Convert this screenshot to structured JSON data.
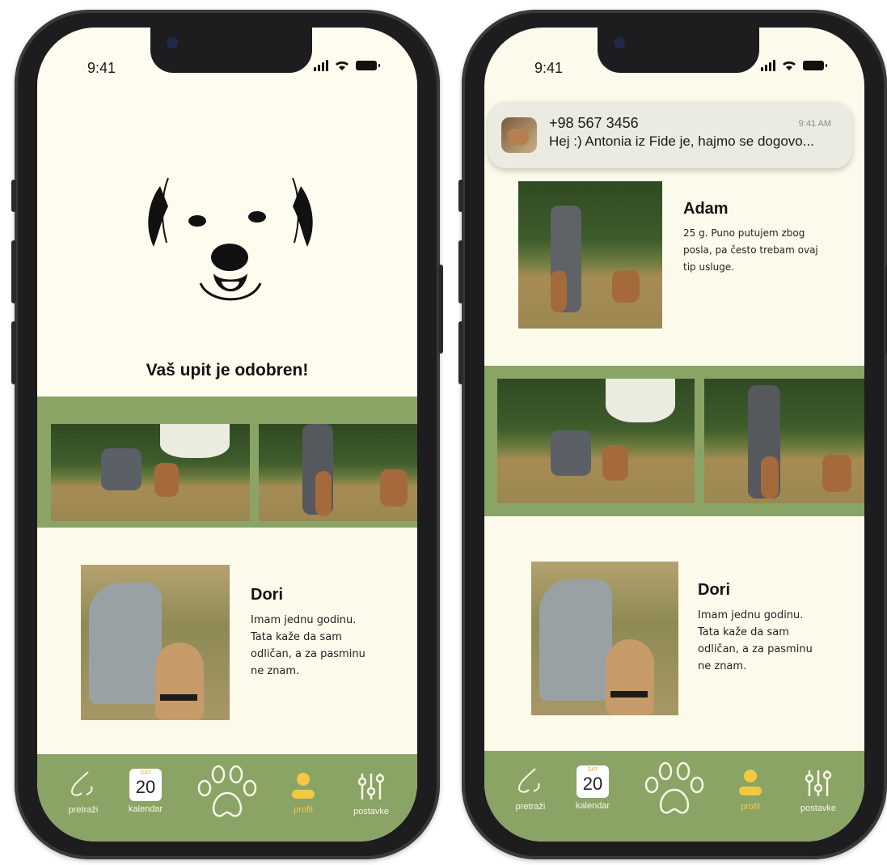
{
  "left_phone": {
    "status": {
      "time": "9:41"
    },
    "overlay": {
      "message": "Vaš upit je odobren!",
      "icon": "dog-face-illustration"
    },
    "profile": {
      "name": "Dori",
      "bio_lines": [
        "Imam jednu godinu.",
        "Tata kaže da sam",
        "odličan, a za pasminu",
        "ne znam."
      ]
    }
  },
  "right_phone": {
    "status": {
      "time": "9:41"
    },
    "notification": {
      "sender": "+98 567 3456",
      "time": "9:41 AM",
      "text": "Hej :) Antonia iz Fide je, hajmo se dogovo..."
    },
    "owner": {
      "name": "Adam",
      "bio_lines": [
        "25 g. Puno putujem zbog",
        "posla, pa često trebam ovaj",
        "tip usluge."
      ]
    },
    "profile": {
      "name": "Dori",
      "bio_lines": [
        "Imam jednu godinu.",
        "Tata kaže da sam",
        "odličan, a za pasminu",
        "ne znam."
      ]
    }
  },
  "nav": {
    "items": [
      {
        "label": "pretraži",
        "icon": "nose-search-icon"
      },
      {
        "label": "kalendar",
        "icon": "calendar-icon",
        "cal_day": "SAT",
        "cal_date": "20"
      },
      {
        "label": "",
        "icon": "paw-icon"
      },
      {
        "label": "profil",
        "icon": "profile-icon",
        "active": true
      },
      {
        "label": "postavke",
        "icon": "sliders-icon"
      }
    ]
  },
  "colors": {
    "accent_green": "#8aa466",
    "background": "#fcfbeb",
    "active_yellow": "#f5c842"
  }
}
